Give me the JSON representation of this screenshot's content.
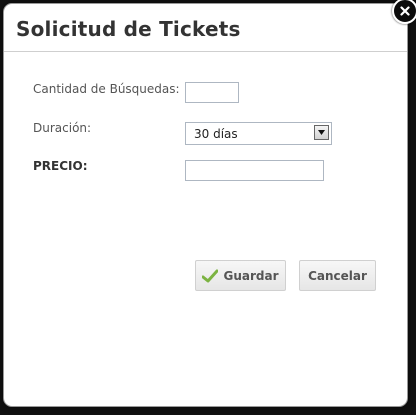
{
  "dialog": {
    "title": "Solicitud de Tickets"
  },
  "form": {
    "cantidad_label": "Cantidad de Búsquedas:",
    "cantidad_value": "",
    "duracion_label": "Duración:",
    "duracion_selected": "30 días",
    "precio_label": "PRECIO:",
    "precio_value": ""
  },
  "buttons": {
    "save_label": "Guardar",
    "cancel_label": "Cancelar"
  },
  "icons": {
    "close": "close-icon",
    "save": "checkmark-icon",
    "dropdown": "chevron-down-icon"
  },
  "colors": {
    "checkmark": "#7cb342",
    "close_bg": "#0b0b0b"
  }
}
